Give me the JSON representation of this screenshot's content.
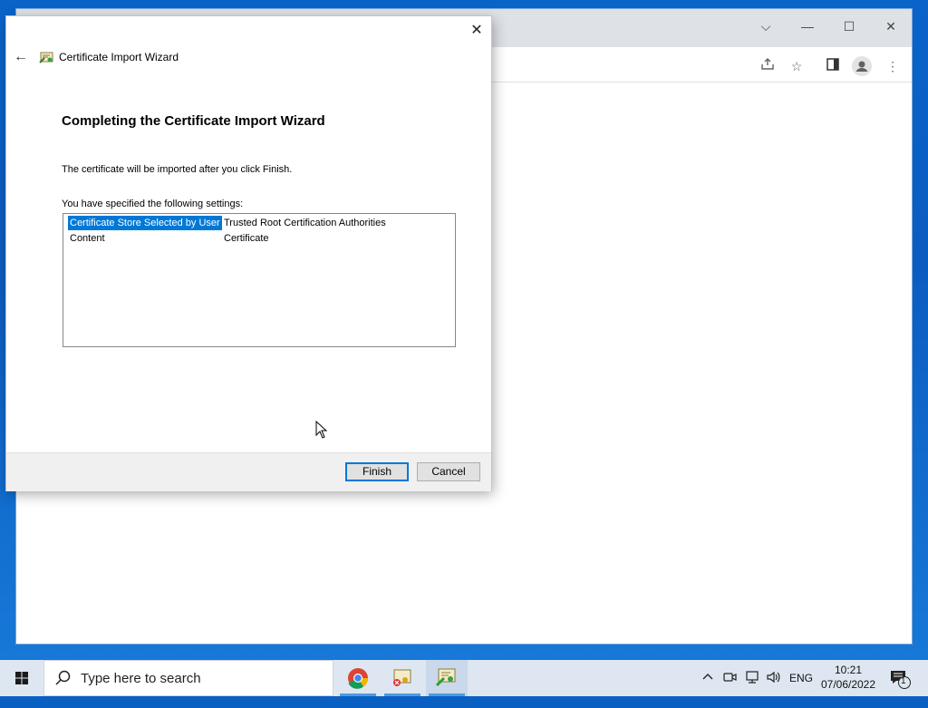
{
  "dialog": {
    "title": "Certificate Import Wizard",
    "heading": "Completing the Certificate Import Wizard",
    "info": "The certificate will be imported after you click Finish.",
    "settings_label": "You have specified the following settings:",
    "settings": [
      {
        "key": "Certificate Store Selected by User",
        "value": "Trusted Root Certification Authorities"
      },
      {
        "key": "Content",
        "value": "Certificate"
      }
    ],
    "finish_label": "Finish",
    "cancel_label": "Cancel"
  },
  "taskbar": {
    "search_placeholder": "Type here to search",
    "language": "ENG",
    "time": "10:21",
    "date": "07/06/2022",
    "notification_count": "1"
  },
  "colors": {
    "selection": "#0078d7",
    "desktop": "#0a63c9"
  },
  "icons": [
    "back-arrow-icon",
    "certificate-icon",
    "close-icon",
    "share-icon",
    "star-icon",
    "side-panel-icon",
    "profile-icon",
    "more-icon",
    "windows-start-icon",
    "search-icon",
    "chrome-icon",
    "cert-manager-icon",
    "wizard-icon",
    "chevron-up-icon",
    "meet-now-icon",
    "network-icon",
    "volume-icon",
    "notification-icon"
  ]
}
